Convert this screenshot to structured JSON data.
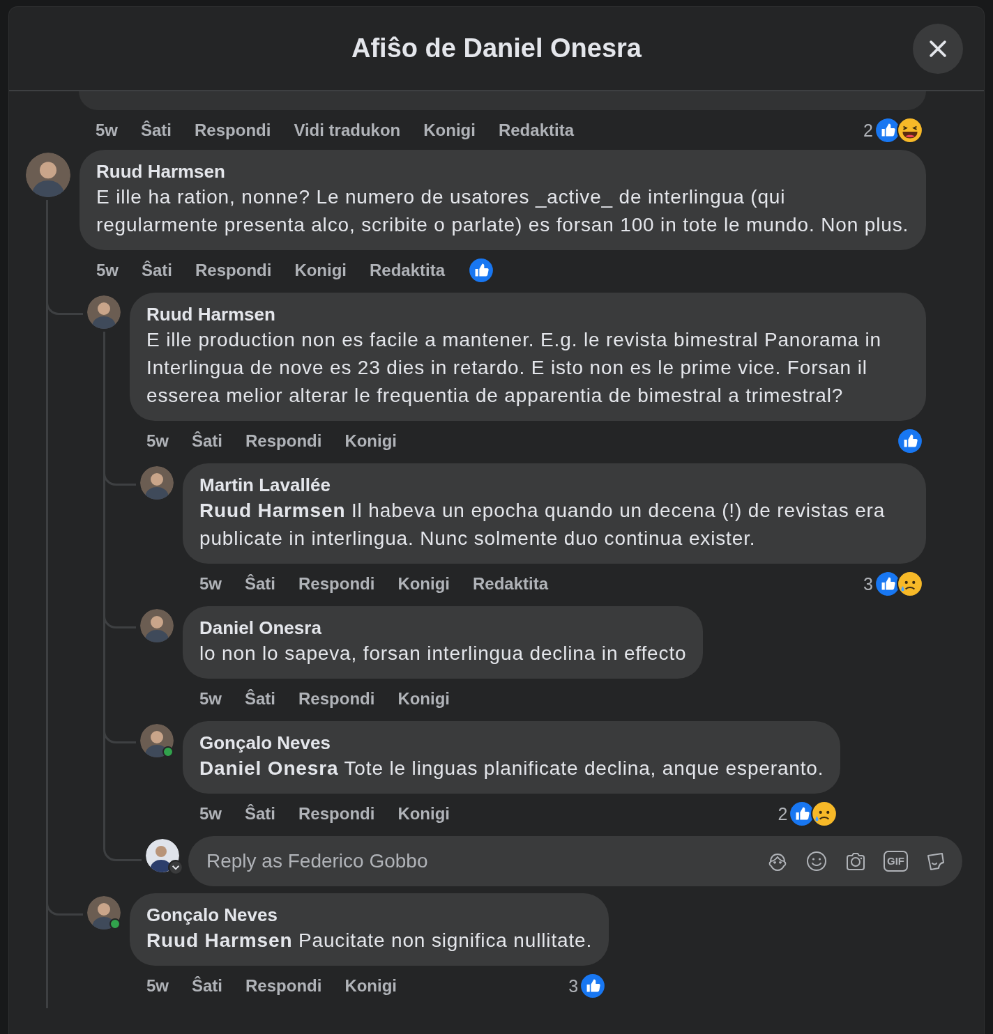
{
  "dialog": {
    "title": "Afiŝo de Daniel Onesra"
  },
  "comments": [
    {
      "kind": "cut_comment",
      "time": "5w",
      "actions": [
        "Ŝati",
        "Respondi",
        "Vidi tradukon",
        "Konigi",
        "Redaktita"
      ],
      "reactions": {
        "count": "2",
        "items": [
          {
            "kind": "like"
          },
          {
            "kind": "haha"
          }
        ]
      }
    },
    {
      "kind": "comment",
      "author": "Ruud Harmsen",
      "online": false,
      "text": "E ille ha ration, nonne? Le numero de usatores _active_ de interlingua (qui regularmente presenta alco, scribite o parlate) es forsan 100 in tote le mundo. Non plus.",
      "time": "5w",
      "actions": [
        "Ŝati",
        "Respondi",
        "Konigi",
        "Redaktita"
      ],
      "inline_reactions": {
        "items": [
          {
            "kind": "like"
          }
        ]
      },
      "children": [
        {
          "kind": "comment",
          "author": "Ruud Harmsen",
          "online": false,
          "text": "E ille production non es facile a mantener. E.g. le revista bimestral Panorama in Interlingua de nove es 23 dies in retardo. E isto non es le prime vice. Forsan il esserea melior alterar le frequentia de apparentia de bimestral a trimestral?",
          "time": "5w",
          "actions": [
            "Ŝati",
            "Respondi",
            "Konigi"
          ],
          "reactions": {
            "items": [
              {
                "kind": "like"
              }
            ]
          },
          "children": [
            {
              "kind": "comment",
              "author": "Martin Lavallée",
              "online": false,
              "text": "**Ruud Harmsen** Il habeva un epocha quando un decena (!) de revistas era publicate in interlingua. Nunc solmente duo continua exister.",
              "time": "5w",
              "actions": [
                "Ŝati",
                "Respondi",
                "Konigi",
                "Redaktita"
              ],
              "reactions": {
                "count": "3",
                "items": [
                  {
                    "kind": "like"
                  },
                  {
                    "kind": "sad"
                  }
                ]
              }
            },
            {
              "kind": "comment",
              "author": "Daniel Onesra",
              "online": false,
              "text": "lo non lo sapeva, forsan interlingua declina in effecto",
              "time": "5w",
              "actions": [
                "Ŝati",
                "Respondi",
                "Konigi"
              ]
            },
            {
              "kind": "comment",
              "author": "Gonçalo Neves",
              "online": true,
              "text": "**Daniel Onesra** Tote le linguas planificate declina, anque esperanto.",
              "time": "5w",
              "actions": [
                "Ŝati",
                "Respondi",
                "Konigi"
              ],
              "reactions": {
                "count": "2",
                "items": [
                  {
                    "kind": "like"
                  },
                  {
                    "kind": "sad"
                  }
                ]
              }
            },
            {
              "kind": "reply_box",
              "placeholder": "Reply as Federico Gobbo",
              "gif_label": "GIF"
            }
          ]
        },
        {
          "kind": "comment",
          "author": "Gonçalo Neves",
          "online": true,
          "text": "**Ruud Harmsen** Paucitate non significa nullitate.",
          "time": "5w",
          "actions": [
            "Ŝati",
            "Respondi",
            "Konigi"
          ],
          "reactions": {
            "count": "3",
            "items": [
              {
                "kind": "like"
              }
            ]
          }
        }
      ]
    }
  ]
}
